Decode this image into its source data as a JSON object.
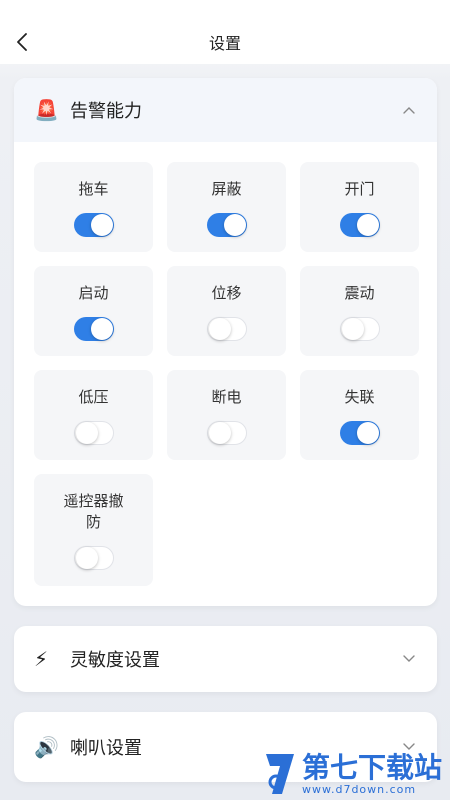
{
  "header": {
    "title": "设置",
    "back_icon": "chevron-left-icon"
  },
  "alarm": {
    "icon": "🚨",
    "title": "告警能力",
    "expanded": true,
    "items": [
      {
        "label": "拖车",
        "on": true
      },
      {
        "label": "屏蔽",
        "on": true
      },
      {
        "label": "开门",
        "on": true
      },
      {
        "label": "启动",
        "on": true
      },
      {
        "label": "位移",
        "on": false
      },
      {
        "label": "震动",
        "on": false
      },
      {
        "label": "低压",
        "on": false
      },
      {
        "label": "断电",
        "on": false
      },
      {
        "label": "失联",
        "on": true
      },
      {
        "label": "遥控器撤防",
        "on": false
      }
    ]
  },
  "sensitivity": {
    "icon": "⚡",
    "title": "灵敏度设置",
    "expanded": false
  },
  "speaker": {
    "icon": "🔊",
    "title": "喇叭设置",
    "expanded": false
  },
  "watermark": {
    "cn": "第七下载站",
    "url": "www.d7down.com"
  },
  "colors": {
    "accent": "#2f7fe6",
    "tile_bg": "#f5f6f8"
  }
}
